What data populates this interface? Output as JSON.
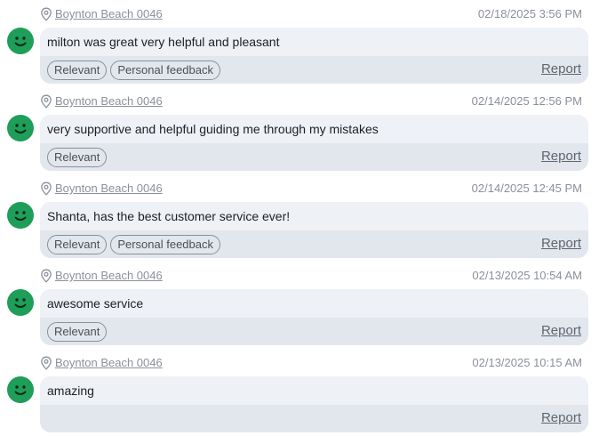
{
  "colors": {
    "avatar_green": "#1e9e58",
    "comment_background": "#eef1f5",
    "footer_background": "#e2e7ee",
    "muted_text": "#8a909a"
  },
  "icons": {
    "avatar": "smiley-face-icon",
    "location": "map-pin-icon"
  },
  "feedback": [
    {
      "location": "Boynton Beach 0046",
      "timestamp": "02/18/2025 3:56 PM",
      "comment": "milton was great very helpful and pleasant",
      "tags": [
        "Relevant",
        "Personal feedback"
      ],
      "report": "Report"
    },
    {
      "location": "Boynton Beach 0046",
      "timestamp": "02/14/2025 12:56 PM",
      "comment": "very supportive and helpful guiding me through my mistakes",
      "tags": [
        "Relevant"
      ],
      "report": "Report"
    },
    {
      "location": "Boynton Beach 0046",
      "timestamp": "02/14/2025 12:45 PM",
      "comment": "Shanta, has the best customer service ever!",
      "tags": [
        "Relevant",
        "Personal feedback"
      ],
      "report": "Report"
    },
    {
      "location": "Boynton Beach 0046",
      "timestamp": "02/13/2025 10:54 AM",
      "comment": "awesome service",
      "tags": [
        "Relevant"
      ],
      "report": "Report"
    },
    {
      "location": "Boynton Beach 0046",
      "timestamp": "02/13/2025 10:15 AM",
      "comment": "amazing",
      "tags": [],
      "report": "Report"
    }
  ]
}
